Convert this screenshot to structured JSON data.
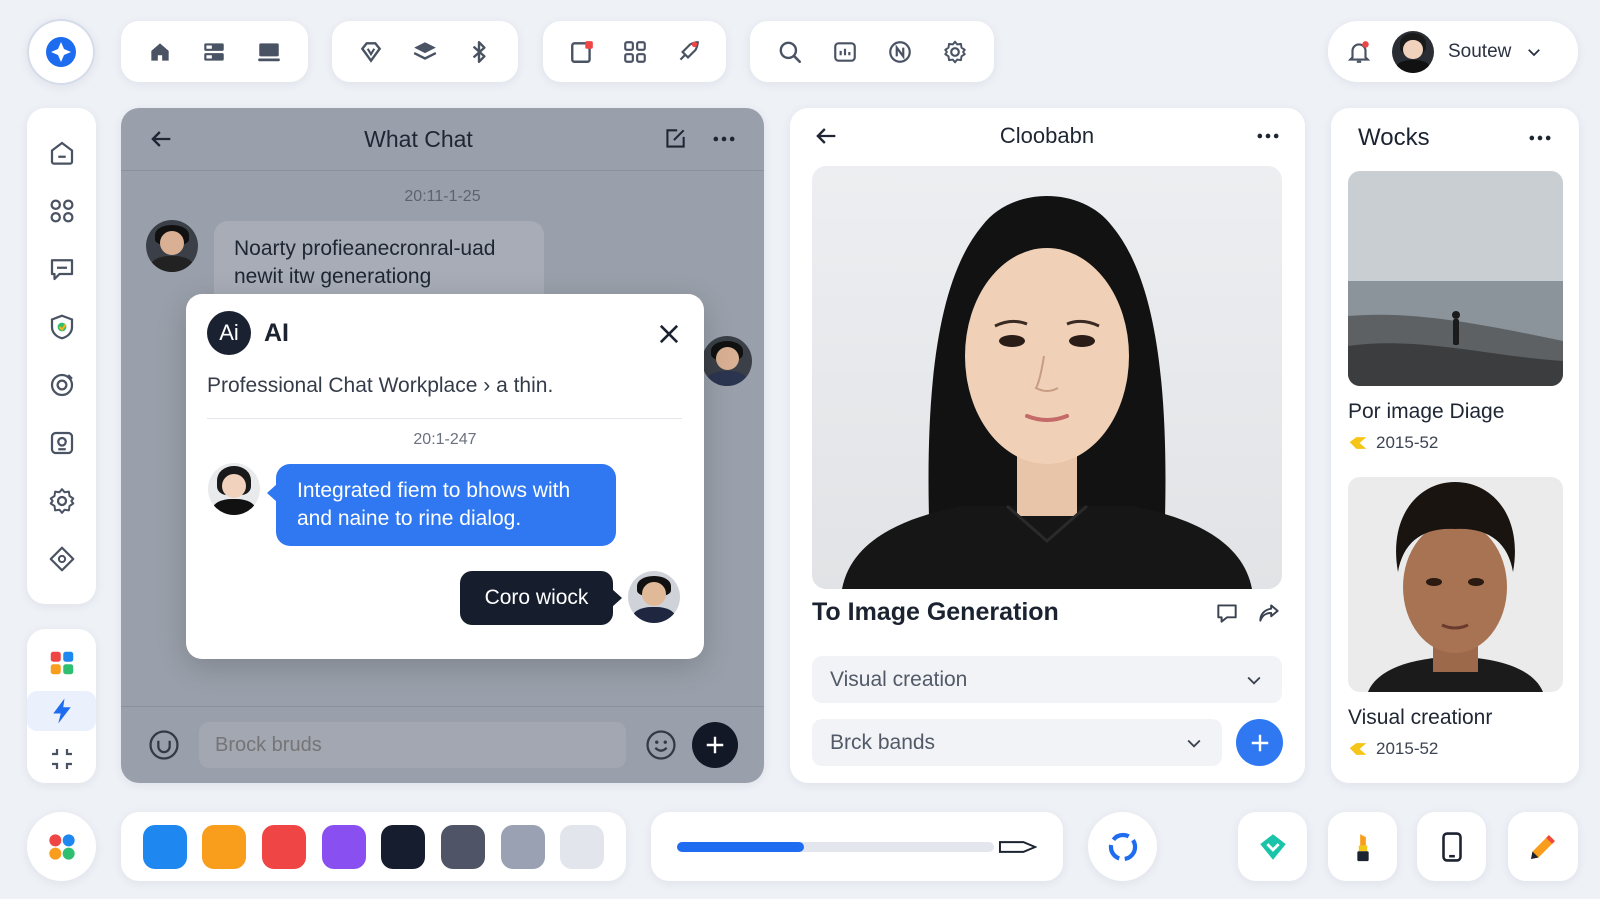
{
  "header": {
    "user_name": "Soutew"
  },
  "chat": {
    "title": "What Chat",
    "timestamp": "20:11-1-25",
    "incoming_message": "Noarty profieanecronral-uad newit itw generationg",
    "input_placeholder": "Brock bruds"
  },
  "dialog": {
    "badge": "Ai",
    "title": "AI",
    "subtitle": "Professional Chat Workplace › a thin.",
    "timestamp": "20:1-247",
    "message": "Integrated fiem to bhows with and naine to rine dialog.",
    "reply": "Coro wiock"
  },
  "generation": {
    "title": "Cloobabn",
    "section_title": "To Image Generation",
    "select_primary": "Visual creation",
    "select_secondary": "Brck bands"
  },
  "works": {
    "title": "Wocks",
    "items": [
      {
        "title": "Por image Diage",
        "date": "2015-52"
      },
      {
        "title": "Visual creationr",
        "date": "2015-52"
      }
    ]
  },
  "palette": {
    "colors": [
      "#1e88f0",
      "#f99d1c",
      "#f04545",
      "#8a4ff0",
      "#161d2f",
      "#4f5566",
      "#9aa1b2",
      "#e2e5ec"
    ]
  },
  "slider": {
    "value": 0.4
  },
  "accent_color": "#2f78f2"
}
